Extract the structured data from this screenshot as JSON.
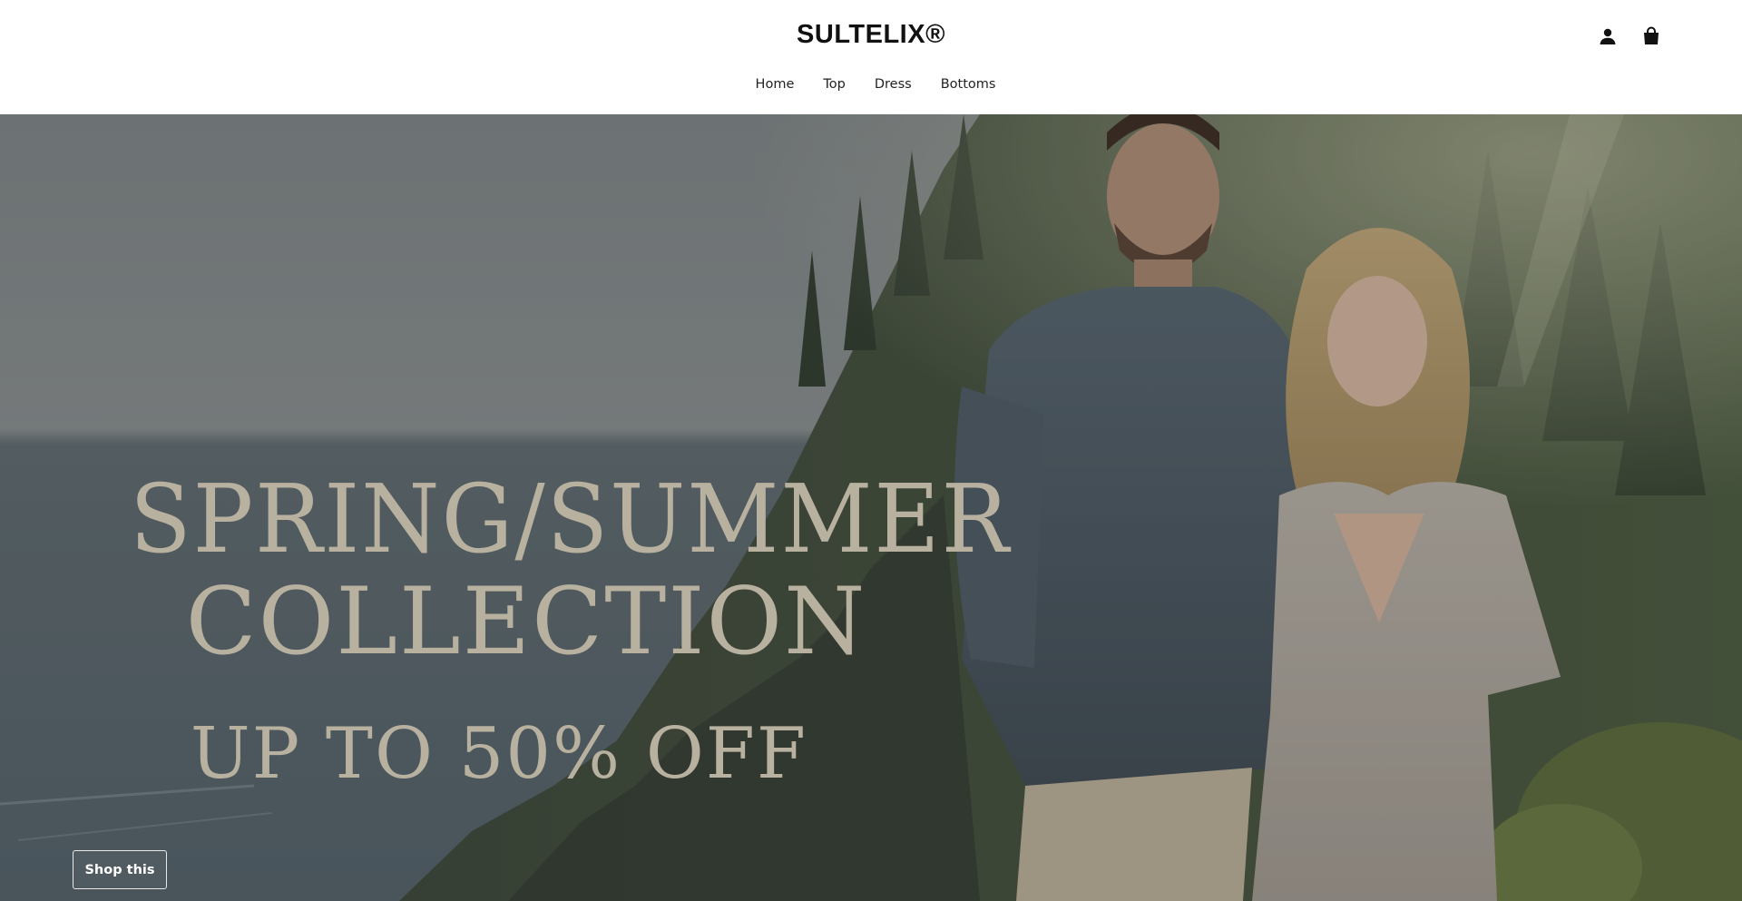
{
  "header": {
    "brand": "SULTELIX®",
    "nav": [
      "Home",
      "Top",
      "Dress",
      "Bottoms"
    ],
    "icons": [
      "account-icon",
      "shopping-bag-icon"
    ]
  },
  "hero": {
    "headline_line1": "SPRING/SUMMER",
    "headline_line2": "COLLECTION",
    "headline_line3": "UP TO 50% OFF",
    "cta_label": "Shop this"
  },
  "colors": {
    "headline": "#b8b19f",
    "header_bg": "#ffffff",
    "text": "#111111"
  }
}
